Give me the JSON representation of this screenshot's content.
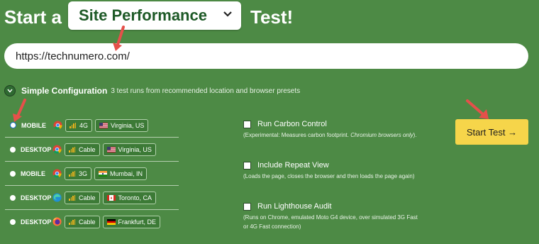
{
  "header": {
    "start_word": "Start a",
    "test_type": "Site Performance",
    "test_word": "Test!"
  },
  "url_input": {
    "value": "https://technumero.com/"
  },
  "simple_config": {
    "title": "Simple Configuration",
    "description": "3 test runs from recommended location and browser presets"
  },
  "presets": [
    {
      "device": "MOBILE",
      "browser": "chrome-icon",
      "connection": "4G",
      "location": "Virginia, US",
      "flag": "us-flag-icon",
      "selected": true
    },
    {
      "device": "DESKTOP",
      "browser": "chrome-icon",
      "connection": "Cable",
      "location": "Virginia, US",
      "flag": "us-flag-icon",
      "selected": false
    },
    {
      "device": "MOBILE",
      "browser": "chrome-icon",
      "connection": "3G",
      "location": "Mumbai, IN",
      "flag": "india-flag-icon",
      "selected": false
    },
    {
      "device": "DESKTOP",
      "browser": "edge-icon",
      "connection": "Cable",
      "location": "Toronto, CA",
      "flag": "canada-flag-icon",
      "selected": false
    },
    {
      "device": "DESKTOP",
      "browser": "firefox-icon",
      "connection": "Cable",
      "location": "Frankfurt, DE",
      "flag": "germany-flag-icon",
      "selected": false
    }
  ],
  "options": {
    "carbon": {
      "label": "Run Carbon Control",
      "desc_main": "(Experimental: Measures carbon footprint. ",
      "desc_em": "Chromium browsers only",
      "desc_tail": ")."
    },
    "repeat": {
      "label": "Include Repeat View",
      "desc": "(Loads the page, closes the browser and then loads the page again)"
    },
    "lighthouse": {
      "label": "Run Lighthouse Audit",
      "desc": "(Runs on Chrome, emulated Moto G4 device, over simulated 3G Fast or 4G Fast connection)"
    }
  },
  "start_button": {
    "label": "Start Test →"
  },
  "colors": {
    "background": "#4d8a45",
    "accent_button": "#f6d54a",
    "annotation_arrow": "#e5504a"
  }
}
